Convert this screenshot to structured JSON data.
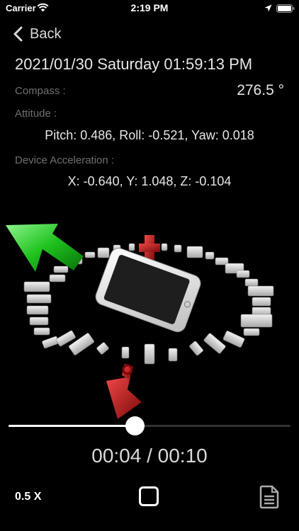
{
  "status_bar": {
    "carrier": "Carrier",
    "time": "2:19 PM",
    "icons": [
      "wifi-icon",
      "location-arrow-icon",
      "battery-icon"
    ]
  },
  "nav": {
    "back_label": "Back",
    "back_icon": "chevron-left-icon"
  },
  "info": {
    "datetime": "2021/01/30 Saturday 01:59:13 PM",
    "compass_label": "Compass :",
    "compass_value": "276.5 °",
    "attitude_label": "Attitude :",
    "attitude_value": "Pitch: 0.486, Roll: -0.521, Yaw: 0.018",
    "acceleration_label": "Device Acceleration :",
    "acceleration_value": "X: -0.640, Y: 1.048, Z: -0.104"
  },
  "scene": {
    "description_icons": [
      "green-arrow-icon",
      "red-arrow-icon",
      "red-north-marker-icon",
      "phone-model-icon",
      "compass-ring-icon"
    ],
    "colors": {
      "green_arrow": "#22c522",
      "red_arrow": "#c41616",
      "ring": "#cfcfcf"
    }
  },
  "playback": {
    "progress": 0.45,
    "timecode": "00:04 / 00:10",
    "speed_label": "0.5 X",
    "stop_icon": "stop-icon",
    "doc_icon": "document-icon"
  }
}
